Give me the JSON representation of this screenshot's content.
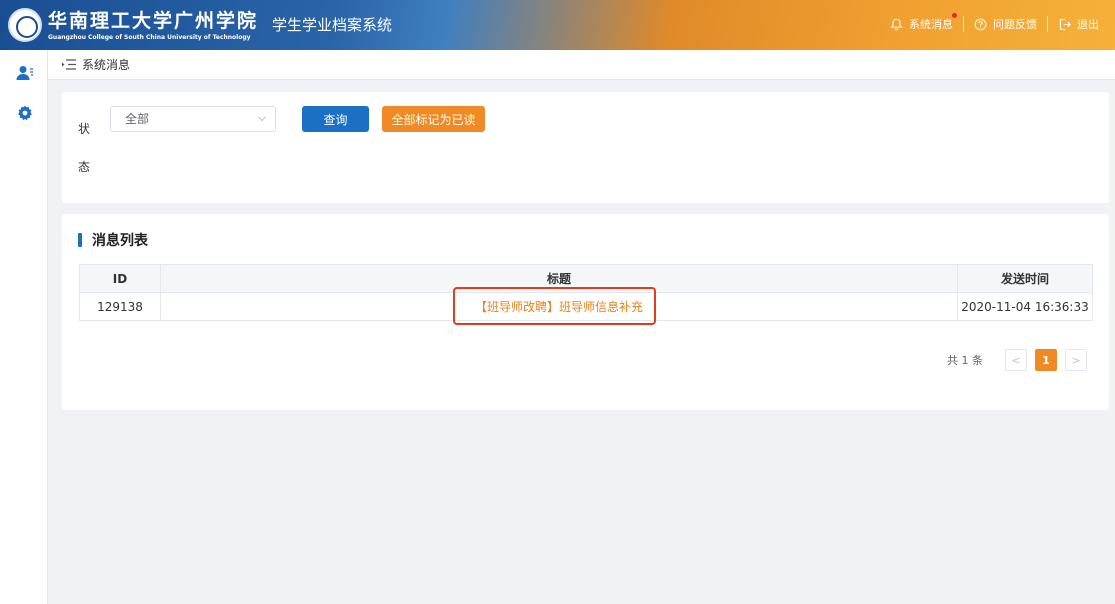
{
  "header": {
    "school_cn": "华南理工大学广州学院",
    "school_en": "Guangzhou College of South China University of Technology",
    "system_title": "学生学业档案系统",
    "links": {
      "messages": "系统消息",
      "feedback": "问题反馈",
      "logout": "退出"
    }
  },
  "breadcrumb": {
    "current": "系统消息"
  },
  "filter": {
    "status_label": "状态",
    "status_value": "全部",
    "query_button": "查询",
    "mark_all_button": "全部标记为已读"
  },
  "list": {
    "section_title": "消息列表",
    "columns": [
      "ID",
      "标题",
      "发送时间"
    ],
    "rows": [
      {
        "id": "129138",
        "title": "【班导师改聘】班导师信息补充",
        "time": "2020-11-04 16:36:33"
      }
    ]
  },
  "pagination": {
    "total_text": "共 1 条",
    "prev": "<",
    "current_page": "1",
    "next": ">"
  },
  "colors": {
    "primary_blue": "#1b6fc4",
    "accent_orange": "#f08a24",
    "highlight_red": "#e23b1f"
  }
}
